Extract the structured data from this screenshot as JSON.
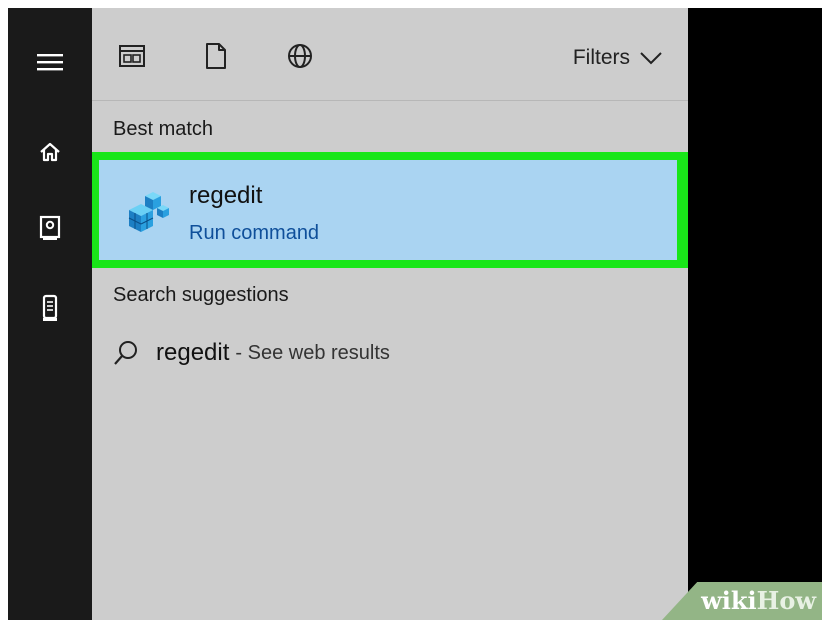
{
  "left_rail": {
    "icons": [
      "hamburger-menu-icon",
      "home-icon",
      "contacts-icon",
      "tower-icon"
    ]
  },
  "toolbar": {
    "icons": [
      "apps-icon",
      "documents-icon",
      "web-icon"
    ],
    "filters_label": "Filters"
  },
  "results": {
    "best_match_label": "Best match",
    "best_match": {
      "name": "regedit",
      "type": "Run command",
      "icon": "registry-editor-icon"
    },
    "suggestions_label": "Search suggestions",
    "suggestions": [
      {
        "term": "regedit",
        "hint": "- See web results",
        "icon": "search-icon"
      }
    ]
  },
  "watermark": {
    "part1": "wiki",
    "part2": "How"
  },
  "colors": {
    "highlight_border": "#19e619",
    "selected_bg": "#aad4f2",
    "panel_bg": "#cdcdcd",
    "link_blue": "#0f4f9a"
  }
}
